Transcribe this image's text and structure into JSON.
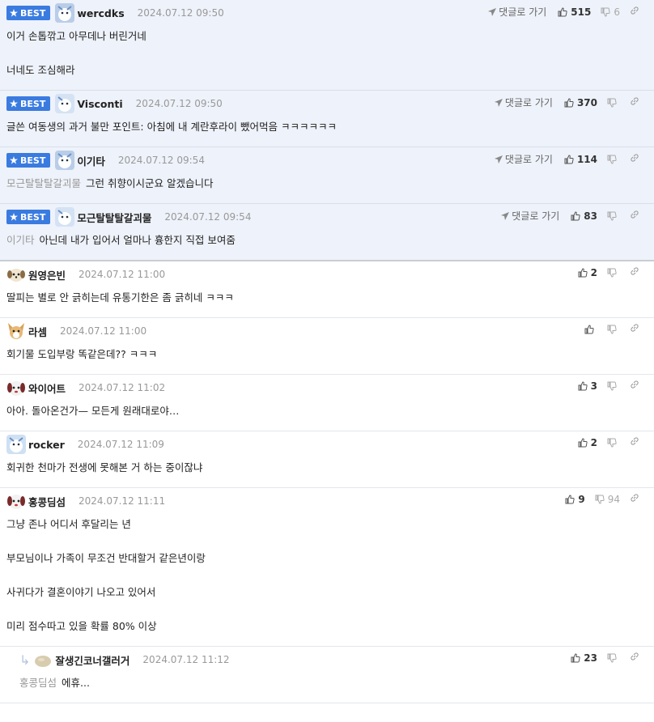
{
  "ui": {
    "best_label": "BEST",
    "goto_label": "댓글로 가기"
  },
  "comments": [
    {
      "best": true,
      "nick": "wercdks",
      "date": "2024.07.12 09:50",
      "up": "515",
      "down": "6",
      "mention": "",
      "lines": [
        "이거 손톱깎고 아무데나 버린거네",
        "",
        "너네도 조심해라"
      ]
    },
    {
      "best": true,
      "nick": "Visconti",
      "date": "2024.07.12 09:50",
      "up": "370",
      "down": "",
      "mention": "",
      "lines": [
        "글쓴 여동생의 과거 불만 포인트: 아침에 내 계란후라이 뺐어먹음 ㅋㅋㅋㅋㅋㅋ"
      ]
    },
    {
      "best": true,
      "nick": "이기타",
      "date": "2024.07.12 09:54",
      "up": "114",
      "down": "",
      "mention": "모근탈탈탈갈괴물",
      "lines": [
        "그런 취향이시군요 알겠습니다"
      ]
    },
    {
      "best": true,
      "nick": "모근탈탈탈갈괴물",
      "date": "2024.07.12 09:54",
      "up": "83",
      "down": "",
      "mention": "이기타",
      "lines": [
        "아닌데 내가 입어서 얼마나 흉한지 직접 보여줌"
      ]
    },
    {
      "best": false,
      "nick": "원영은빈",
      "date": "2024.07.12 11:00",
      "up": "2",
      "down": "",
      "mention": "",
      "lines": [
        "딸피는 별로 안 긁히는데 유통기한은 좀 긁히네 ㅋㅋㅋ"
      ]
    },
    {
      "best": false,
      "nick": "라셈",
      "date": "2024.07.12 11:00",
      "up": "",
      "down": "",
      "mention": "",
      "lines": [
        "회기물 도입부랑 똑같은데?? ㅋㅋㅋ"
      ]
    },
    {
      "best": false,
      "nick": "와이어트",
      "date": "2024.07.12 11:02",
      "up": "3",
      "down": "",
      "mention": "",
      "lines": [
        "아아. 돌아온건가— 모든게 원래대로야…"
      ]
    },
    {
      "best": false,
      "nick": "rocker",
      "date": "2024.07.12 11:09",
      "up": "2",
      "down": "",
      "mention": "",
      "lines": [
        "회귀한 천마가 전생에 못해본 거 하는 중이잖냐"
      ]
    },
    {
      "best": false,
      "nick": "홍콩딤섬",
      "date": "2024.07.12 11:11",
      "up": "9",
      "down": "94",
      "mention": "",
      "lines": [
        "그냥 존나 어디서 후달리는 년",
        "",
        "부모님이나 가족이 무조건 반대할거 같은년이랑",
        "",
        "사귀다가 결혼이야기 나오고 있어서",
        "",
        "미리 점수따고 있을 확률 80% 이상"
      ]
    },
    {
      "best": false,
      "reply": true,
      "nick": "잘생긴코너갤러거",
      "date": "2024.07.12 11:12",
      "up": "23",
      "down": "",
      "mention": "홍콩딤섬",
      "lines": [
        "에휴..."
      ]
    }
  ]
}
